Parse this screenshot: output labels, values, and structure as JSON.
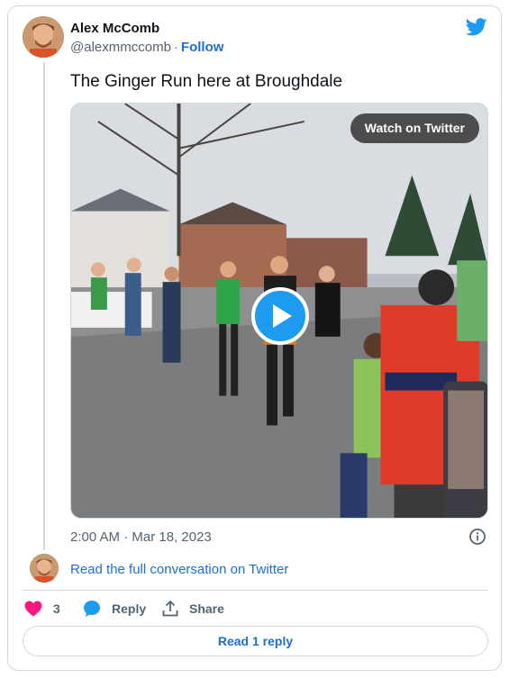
{
  "author": {
    "name": "Alex McComb",
    "handle": "@alexmmccomb",
    "separator": "·",
    "follow_label": "Follow"
  },
  "tweet": {
    "text": "The Ginger Run here at Broughdale",
    "timestamp": "2:00 AM · Mar 18, 2023"
  },
  "media": {
    "watch_label": "Watch on Twitter",
    "type": "video"
  },
  "conversation": {
    "read_full_label": "Read the full conversation on Twitter"
  },
  "actions": {
    "like_count": "3",
    "reply_label": "Reply",
    "share_label": "Share"
  },
  "footer": {
    "read_reply_label": "Read 1 reply"
  },
  "icons": {
    "brand": "twitter-bird-icon",
    "like": "heart-icon",
    "reply": "speech-bubble-icon",
    "share": "share-arrow-icon",
    "info": "info-icon",
    "play": "play-icon"
  },
  "colors": {
    "link": "#1d6fcf",
    "brand_blue": "#1d9bf0",
    "like_pink": "#f91880",
    "muted": "#536471",
    "border": "#cfd9de"
  }
}
